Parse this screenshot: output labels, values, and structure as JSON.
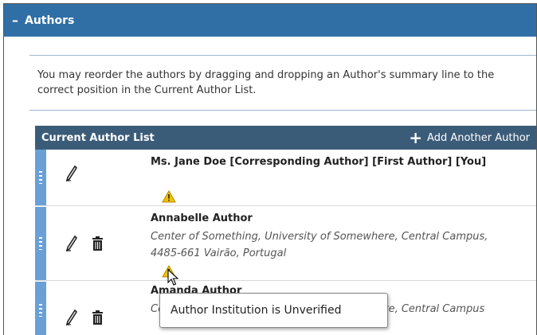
{
  "section": {
    "toggle": "–",
    "title": "Authors"
  },
  "instructions": {
    "text": "You may reorder the authors by dragging and dropping an Author's summary line to the correct position in the Current Author List."
  },
  "author_list": {
    "title": "Current Author List",
    "add_label": "Add Another Author",
    "authors": [
      {
        "name": "Ms. Jane Doe [Corresponding Author] [First Author] [You]",
        "institution": ""
      },
      {
        "name": "Annabelle Author",
        "institution": "Center of Something, University of Somewhere, Central Campus, 4485-661 Vairão, Portugal"
      },
      {
        "name": "Amanda Author",
        "institution": "Center of Something, University of Somewhere, Central Campus"
      }
    ]
  },
  "tooltip": {
    "text": "Author Institution is Unverified"
  },
  "colors": {
    "section_header": "#2f6fa6",
    "list_header": "#3b5c79",
    "handle": "#6aa0d8",
    "warning": "#f2c200"
  },
  "icons": [
    "minus-icon",
    "plus-icon",
    "drag-handle-icon",
    "edit-icon",
    "trash-icon",
    "warning-icon",
    "mouse-cursor-icon"
  ]
}
